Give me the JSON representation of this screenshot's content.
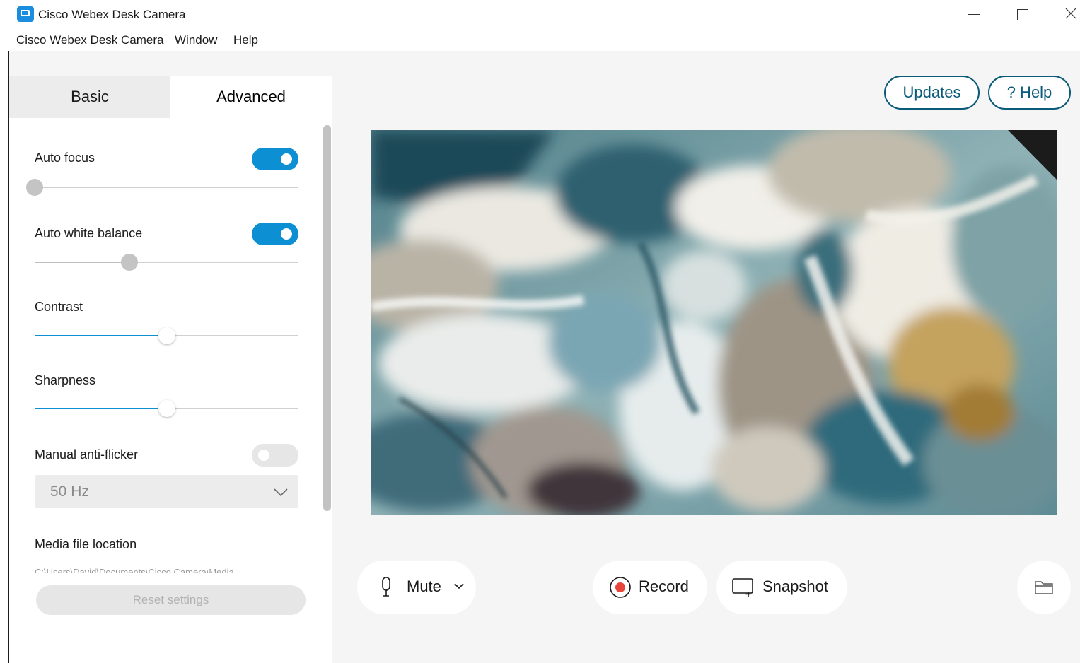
{
  "window": {
    "title": "Cisco Webex Desk Camera",
    "icon": "webex-camera-app-icon"
  },
  "menu": {
    "items": [
      "Cisco Webex Desk Camera",
      "Window",
      "Help"
    ]
  },
  "tabs": {
    "basic": "Basic",
    "advanced": "Advanced",
    "active": "Advanced"
  },
  "settings": {
    "auto_focus": {
      "label": "Auto focus",
      "toggle": "on",
      "slider_value": 0,
      "slider_state": "disabled"
    },
    "auto_white_balance": {
      "label": "Auto white balance",
      "toggle": "on",
      "slider_value": 0.36,
      "slider_state": "disabled"
    },
    "contrast": {
      "label": "Contrast",
      "slider_value": 0.5
    },
    "sharpness": {
      "label": "Sharpness",
      "slider_value": 0.5
    },
    "anti_flicker": {
      "label": "Manual anti-flicker",
      "toggle": "off",
      "frequency": "50 Hz"
    },
    "media_location": {
      "label": "Media file location",
      "path": "C:\\Users\\David\\Documents\\Cisco Camera\\Media"
    },
    "reset_label": "Reset settings"
  },
  "header_buttons": {
    "updates": "Updates",
    "help": "? Help"
  },
  "controls": {
    "mute": "Mute",
    "record": "Record",
    "snapshot": "Snapshot"
  },
  "colors": {
    "accent": "#0d8fd3",
    "outline": "#0a5a7a",
    "record": "#e8453c"
  },
  "icons": {
    "microphone": "microphone-icon",
    "record": "record-icon",
    "snapshot": "snapshot-icon",
    "folder": "folder-icon"
  }
}
